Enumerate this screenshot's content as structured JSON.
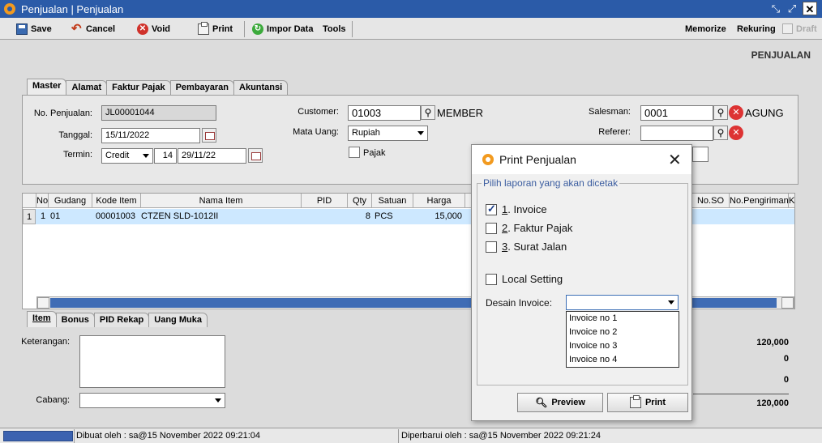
{
  "window": {
    "title": "Penjualan | Penjualan"
  },
  "toolbar": {
    "save": "Save",
    "cancel": "Cancel",
    "void": "Void",
    "print": "Print",
    "import": "Impor Data",
    "tools": "Tools",
    "memorize": "Memorize",
    "rekuring": "Rekuring",
    "draft": "Draft"
  },
  "page_heading": "PENJUALAN",
  "main_tabs": [
    "Master",
    "Alamat",
    "Faktur Pajak",
    "Pembayaran",
    "Akuntansi"
  ],
  "form": {
    "no_penjualan_label": "No. Penjualan:",
    "no_penjualan": "JL00001044",
    "tanggal_label": "Tanggal:",
    "tanggal": "15/11/2022",
    "termin_label": "Termin:",
    "termin": "Credit",
    "termin_days": "14",
    "termin_date": "29/11/22",
    "customer_label": "Customer:",
    "customer_code": "01003",
    "customer_name": "MEMBER",
    "mata_uang_label": "Mata Uang:",
    "mata_uang": "Rupiah",
    "pajak_label": "Pajak",
    "salesman_label": "Salesman:",
    "salesman_code": "0001",
    "salesman_name": "AGUNG",
    "referer_label": "Referer:"
  },
  "grid": {
    "columns": [
      "No",
      "Gudang",
      "Kode Item",
      "Nama Item",
      "PID",
      "Qty",
      "Satuan",
      "Harga",
      "No.SO",
      "No.Pengiriman",
      "K"
    ],
    "rows": [
      {
        "num": "1",
        "no": "1",
        "gudang": "01",
        "kode": "00001003",
        "nama": "CTZEN SLD-1012II",
        "pid": "",
        "qty": "8",
        "satuan": "PCS",
        "harga": "15,000"
      }
    ]
  },
  "bottom_tabs": [
    "Item",
    "Bonus",
    "PID Rekap",
    "Uang Muka"
  ],
  "bottom": {
    "keterangan_label": "Keterangan:",
    "cabang_label": "Cabang:",
    "totals": [
      "120,000",
      "0",
      "0",
      "120,000"
    ]
  },
  "dialog": {
    "title": "Print Penjualan",
    "group_label": "Pilih laporan yang akan dicetak",
    "options": [
      {
        "num": "1",
        "label": ". Invoice",
        "checked": true
      },
      {
        "num": "2",
        "label": ". Faktur Pajak",
        "checked": false
      },
      {
        "num": "3",
        "label": ". Surat Jalan",
        "checked": false
      }
    ],
    "local_setting": "Local Setting",
    "desain_label": "Desain Invoice:",
    "desain_value": "",
    "desain_options": [
      "Invoice no 1",
      "Invoice no 2",
      "Invoice no 3",
      "Invoice no 4"
    ],
    "preview": "Preview",
    "print": "Print"
  },
  "status": {
    "created": "Dibuat oleh : sa@15 November 2022  09:21:04",
    "updated": "Diperbarui oleh : sa@15 November 2022  09:21:24"
  }
}
